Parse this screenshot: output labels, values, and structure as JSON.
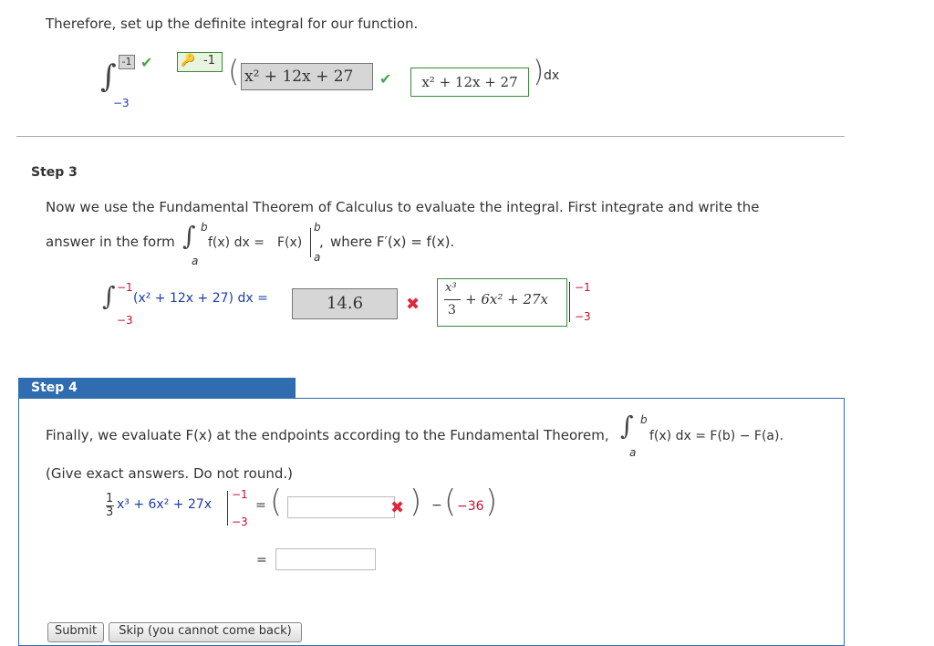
{
  "intro_text": "Therefore, set up the definite integral for our function.",
  "setup": {
    "lower_limit": "−3",
    "upper_limit_value": "-1",
    "key_badge_value": "-1",
    "integrand_answer": "x² + 12x + 27",
    "integrand_correct": "x² + 12x + 27",
    "dx": "dx"
  },
  "step3": {
    "label": "Step 3",
    "line1": "Now we use the Fundamental Theorem of Calculus to evaluate the integral. First integrate and write the",
    "line2_prefix": "answer in the form",
    "form_integrand": "f(x) dx =",
    "form_F": "F(x)",
    "limit_b": "b",
    "limit_a": "a",
    "where_text": "where F′(x) = f(x).",
    "integral_upper": "−1",
    "integral_lower": "−3",
    "integrand": "(x² + 12x + 27) dx =",
    "answer_value": "14.6",
    "correct_expr_num": "x³",
    "correct_expr_den": "3",
    "correct_expr_rest": "+ 6x² + 27x",
    "eval_upper": "−1",
    "eval_lower": "−3"
  },
  "step4": {
    "label": "Step 4",
    "line1": "Finally, we evaluate F(x) at the endpoints according to the Fundamental Theorem,",
    "theorem_rhs": "f(x) dx = F(b) − F(a).",
    "limit_b": "b",
    "limit_a": "a",
    "note": "(Give exact answers. Do not round.)",
    "frac_num": "1",
    "frac_den": "3",
    "expr": "x³ + 6x² + 27x",
    "eval_upper": "−1",
    "eval_lower": "−3",
    "equals": "=",
    "minus": "−",
    "second_value": "−36",
    "first_input_value": "",
    "final_input_value": ""
  },
  "buttons": {
    "submit": "Submit",
    "skip": "Skip (you cannot come back)"
  },
  "colors": {
    "step_tab": "#2f6cb0",
    "check": "#4aa64a",
    "wrong": "#e0263a",
    "limits": "#c8102e"
  }
}
